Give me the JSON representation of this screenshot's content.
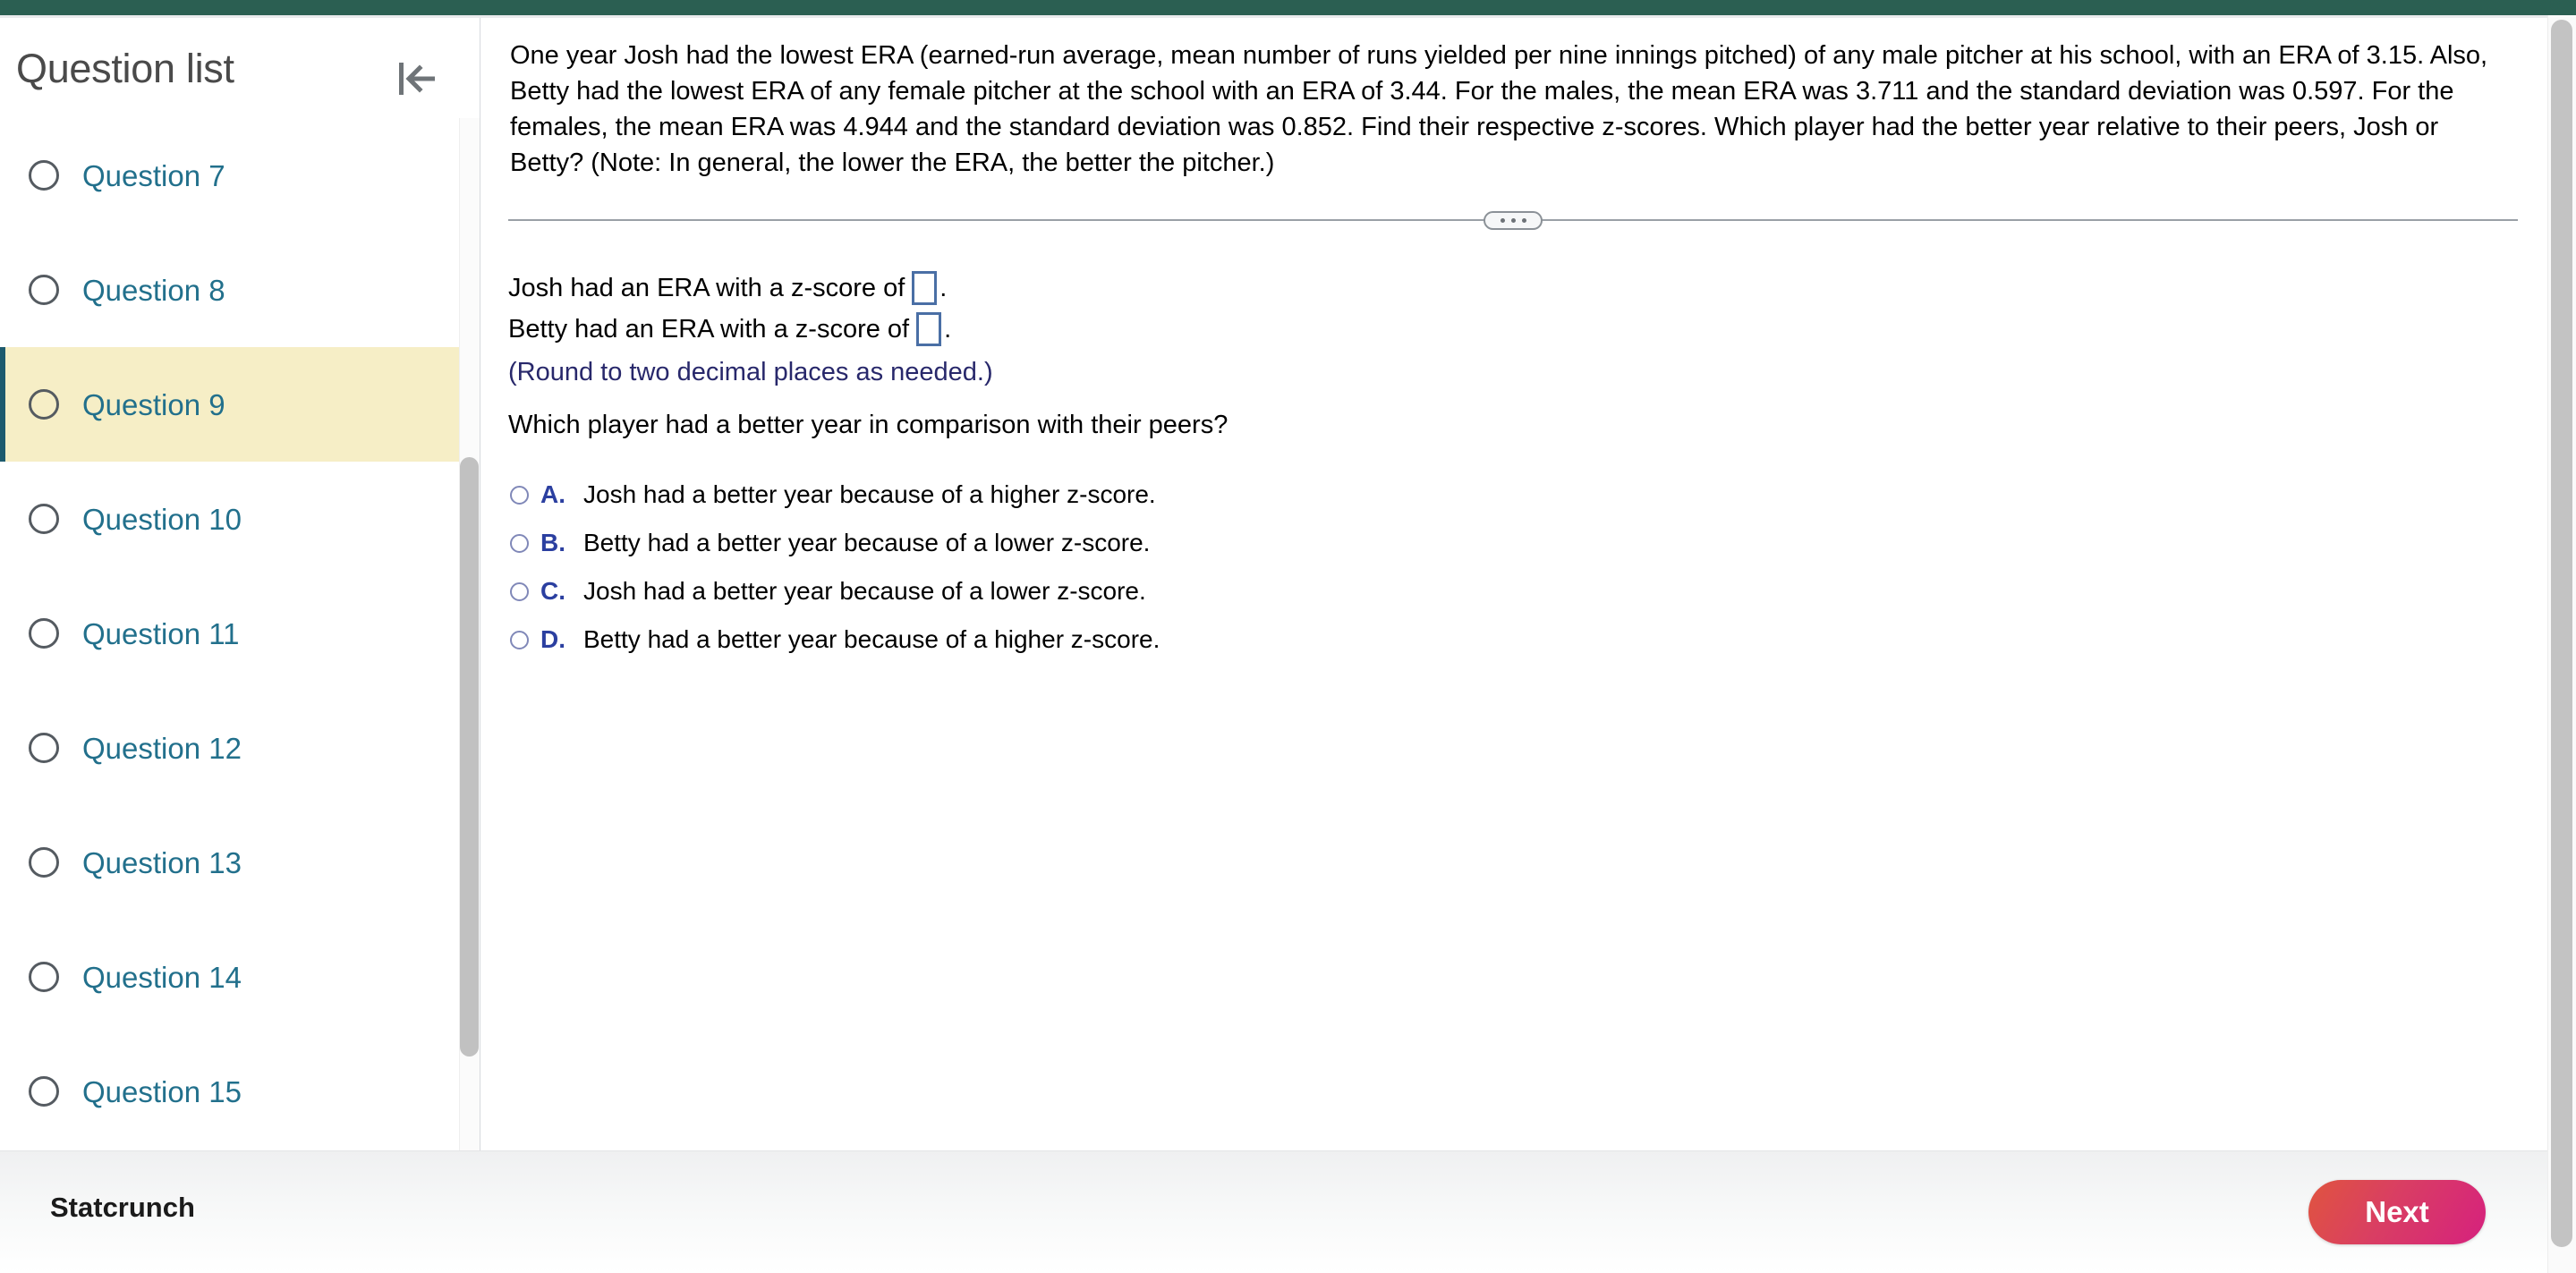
{
  "theme": {
    "topbar_color": "#2b5f52",
    "active_item_bg": "#f6eec6",
    "active_item_border": "#1d5a6e",
    "link_color": "#22708c",
    "note_color": "#28286b",
    "choice_letter_color": "#2b3fa0",
    "input_border_color": "#4a6fa5",
    "next_gradient_from": "#e0543f",
    "next_gradient_to": "#d6217e"
  },
  "sidebar": {
    "title": "Question list",
    "collapse_icon": "collapse-left-icon",
    "items": [
      {
        "label": "Question 7",
        "active": false
      },
      {
        "label": "Question 8",
        "active": false
      },
      {
        "label": "Question 9",
        "active": true
      },
      {
        "label": "Question 10",
        "active": false
      },
      {
        "label": "Question 11",
        "active": false
      },
      {
        "label": "Question 12",
        "active": false
      },
      {
        "label": "Question 13",
        "active": false
      },
      {
        "label": "Question 14",
        "active": false
      },
      {
        "label": "Question 15",
        "active": false
      }
    ]
  },
  "content": {
    "question_text": "One year Josh had the lowest ERA (earned-run average, mean number of runs yielded per nine innings pitched) of any male pitcher at his school, with an ERA of 3.15. Also, Betty had the lowest ERA of any female pitcher at the school with an ERA of 3.44. For the males, the mean ERA was 3.711 and the standard deviation was 0.597. For the females, the mean ERA was 4.944 and the standard deviation was 0.852. Find their respective z-scores. Which player had the better year relative to their peers, Josh or Betty? (Note: In general, the lower the ERA, the better the pitcher.)",
    "divider_handle": "resize-handle-dots",
    "answer_lines": [
      {
        "prefix": "Josh had an ERA with a z-score of",
        "value": "",
        "suffix": "."
      },
      {
        "prefix": "Betty had an ERA with a z-score of",
        "value": "",
        "suffix": "."
      }
    ],
    "round_note": "(Round to two decimal places as needed.)",
    "sub_question": "Which player had a better year in comparison with their peers?",
    "choices": [
      {
        "letter": "A.",
        "text": "Josh had a better year because of a higher z-score.",
        "selected": false
      },
      {
        "letter": "B.",
        "text": "Betty had a better year because of a lower z-score.",
        "selected": false
      },
      {
        "letter": "C.",
        "text": "Josh had a better year because of a lower z-score.",
        "selected": false
      },
      {
        "letter": "D.",
        "text": "Betty had a better year because of a higher z-score.",
        "selected": false
      }
    ]
  },
  "footer": {
    "statcrunch_label": "Statcrunch",
    "next_label": "Next"
  }
}
